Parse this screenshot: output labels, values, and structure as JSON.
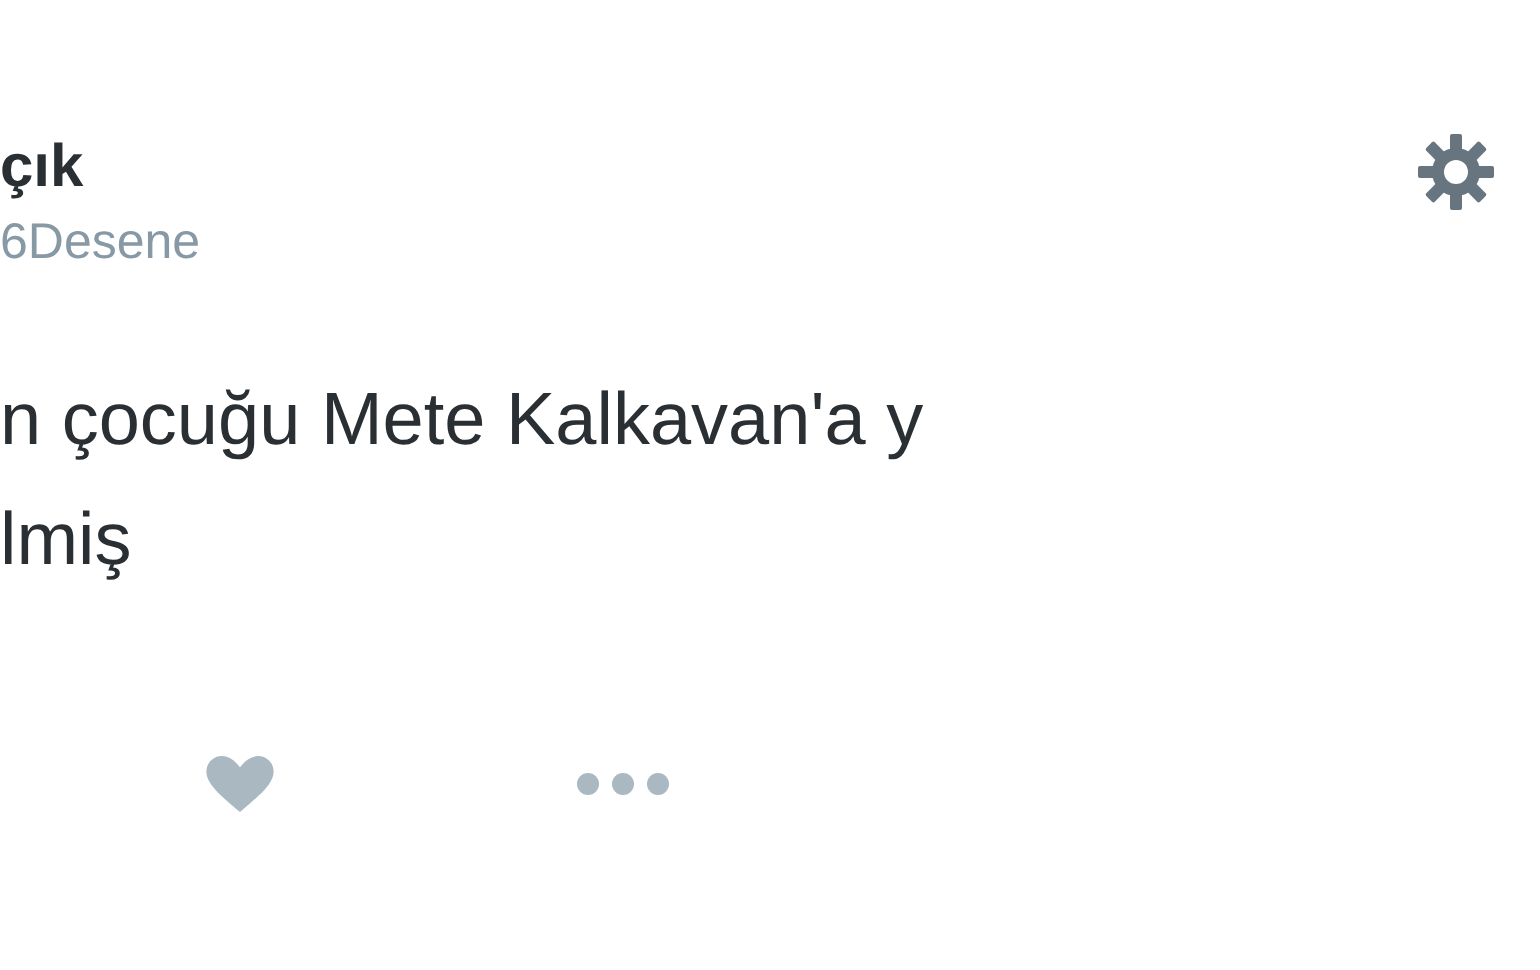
{
  "author": {
    "name": "çık",
    "handle": "6Desene"
  },
  "tweet": {
    "lines": [
      "n çocuğu Mete Kalkavan'a y",
      "lmiş"
    ]
  },
  "actions": [
    {
      "kind": "like"
    },
    {
      "kind": "more"
    }
  ]
}
